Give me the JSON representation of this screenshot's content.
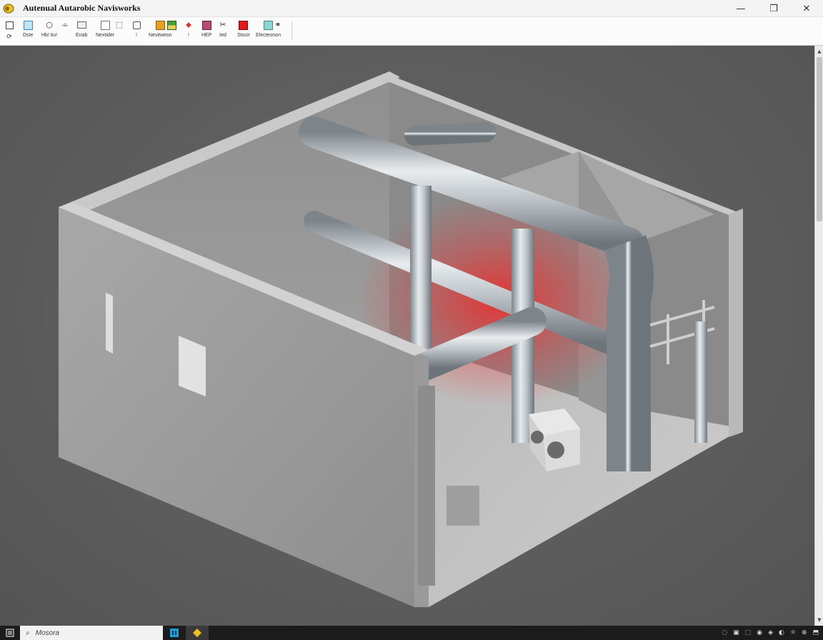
{
  "window": {
    "title": "Autenual Autarobic Navisworks",
    "controls": {
      "minimize": "—",
      "maximize": "❐",
      "close": "✕"
    }
  },
  "ribbon": {
    "row1": [
      {
        "name": "select-icon",
        "glyph": "Ib"
      },
      {
        "name": "window-icon",
        "glyph": "▢"
      },
      {
        "name": "orbit-icon",
        "glyph": "○"
      },
      {
        "name": "measure-icon",
        "glyph": "⌯"
      },
      {
        "name": "comment-icon",
        "glyph": "▭"
      },
      {
        "name": "blank-icon",
        "glyph": ""
      },
      {
        "name": "cursor-box-icon",
        "glyph": "⬚"
      },
      {
        "name": "tag-icon",
        "glyph": "⌾"
      },
      {
        "name": "orange-swatch-icon",
        "glyph": ""
      },
      {
        "name": "green-swatch-icon",
        "glyph": ""
      },
      {
        "name": "red-arrow-icon",
        "glyph": "⬥"
      },
      {
        "name": "magenta-swatch-icon",
        "glyph": ""
      },
      {
        "name": "cut-icon",
        "glyph": "✂"
      },
      {
        "name": "red-swatch-icon",
        "glyph": ""
      },
      {
        "name": "cyan-swatch-icon",
        "glyph": ""
      },
      {
        "name": "link-icon",
        "glyph": "⚭"
      }
    ],
    "labels": [
      "Dste",
      "Hb! tiu!",
      "Enab",
      "Nextider",
      "!",
      "Nevitweon",
      "!",
      "HEP",
      "Ied",
      "Stocir",
      "Electeonon"
    ],
    "colors": {
      "orange": "#e8a020",
      "green": "#4a9e3a",
      "red_arrow": "#d8302a",
      "magenta": "#b84a78",
      "red": "#e01818",
      "cyan": "#8ad8d0",
      "blue": "#3aa0d8"
    }
  },
  "taskbar": {
    "search_text": "Mosora",
    "tray": [
      "◌",
      "▣",
      "⬚",
      "◉",
      "◈",
      "◐",
      "☼",
      "⊕",
      "⬒"
    ]
  }
}
